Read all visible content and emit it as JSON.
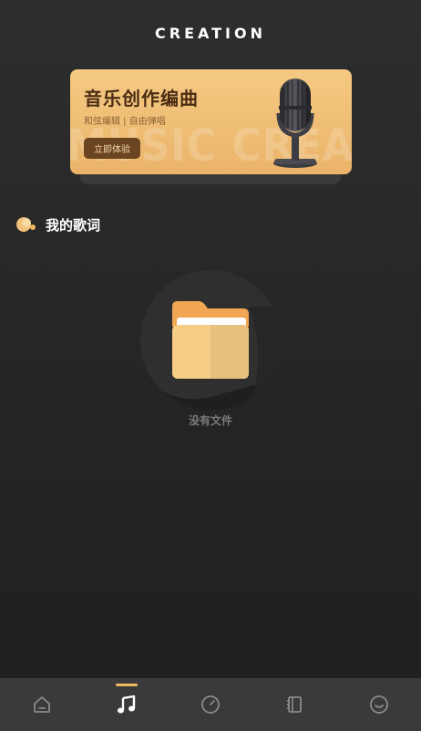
{
  "header": {
    "title": "CREATION"
  },
  "banner": {
    "title": "音乐创作编曲",
    "subtitle": "和弦编辑 | 自由弹唱",
    "button_label": "立即体验",
    "watermark": "MUSIC CREATIO",
    "gradient_top": "#f5c982",
    "gradient_bottom": "#eab46a"
  },
  "section": {
    "title": "我的歌词",
    "icon": "lyrics-bubble-icon"
  },
  "empty_state": {
    "icon": "folder-icon",
    "label": "没有文件"
  },
  "bottom_nav": {
    "items": [
      {
        "name": "home",
        "icon": "home-icon",
        "active": false
      },
      {
        "name": "music",
        "icon": "music-note-icon",
        "active": true
      },
      {
        "name": "compass",
        "icon": "compass-icon",
        "active": false
      },
      {
        "name": "notebook",
        "icon": "notebook-icon",
        "active": false
      },
      {
        "name": "profile",
        "icon": "smile-icon",
        "active": false
      }
    ],
    "accent_color": "#f0b85f"
  }
}
